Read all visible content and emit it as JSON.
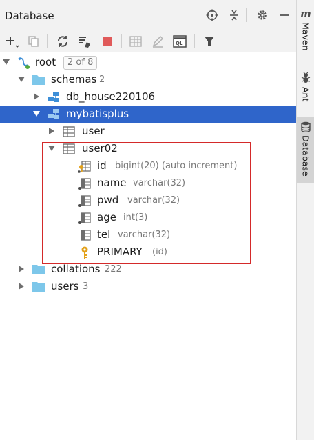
{
  "panel": {
    "title": "Database"
  },
  "tree": {
    "root": {
      "label": "root",
      "badge": "2 of 8"
    },
    "schemas": {
      "label": "schemas",
      "count": "2"
    },
    "db_house": {
      "label": "db_house220106"
    },
    "mybatisplus": {
      "label": "mybatisplus"
    },
    "user": {
      "label": "user"
    },
    "user02": {
      "label": "user02"
    },
    "columns": [
      {
        "name": "id",
        "type": "bigint(20) (auto increment)"
      },
      {
        "name": "name",
        "type": "varchar(32)"
      },
      {
        "name": "pwd",
        "type": "varchar(32)"
      },
      {
        "name": "age",
        "type": "int(3)"
      },
      {
        "name": "tel",
        "type": "varchar(32)"
      }
    ],
    "primary_key": {
      "name": "PRIMARY",
      "cols": "(id)"
    },
    "collations": {
      "label": "collations",
      "count": "222"
    },
    "users": {
      "label": "users",
      "count": "3"
    }
  },
  "side_tabs": {
    "maven": "Maven",
    "ant": "Ant",
    "database": "Database"
  },
  "colors": {
    "selection": "#2f65ca",
    "highlight_border": "#d42a2a",
    "schema_icon": "#3d8fd8",
    "folder": "#7dc7ea"
  }
}
